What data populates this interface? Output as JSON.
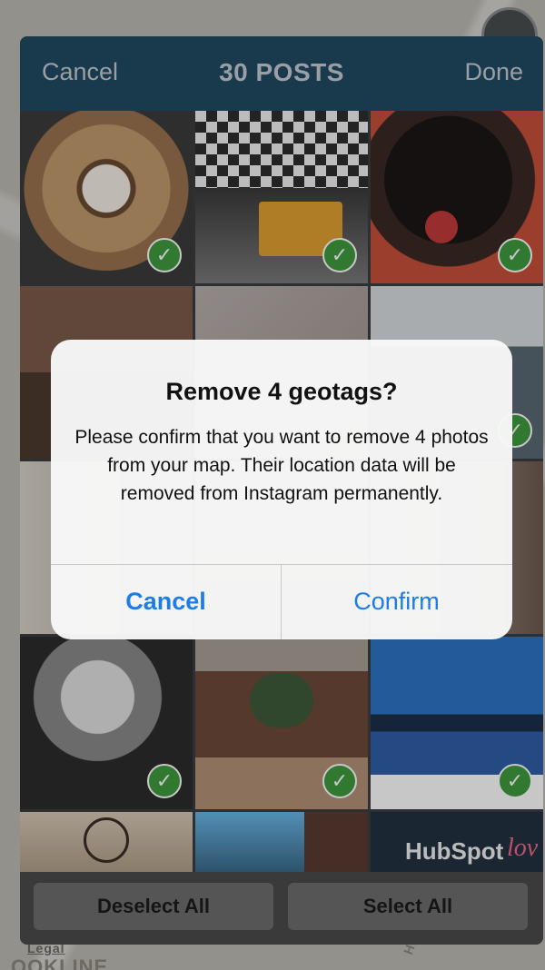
{
  "map": {
    "legal_label": "Legal",
    "area_label": "OOKLINE",
    "street_label": "Hill"
  },
  "nav": {
    "cancel_label": "Cancel",
    "title": "30 POSTS",
    "done_label": "Done"
  },
  "photos": [
    {
      "name": "coffee-on-wood",
      "checked": true
    },
    {
      "name": "espresso-machine",
      "checked": true
    },
    {
      "name": "black-dog",
      "checked": true
    },
    {
      "name": "red-brick-buildings",
      "checked": false
    },
    {
      "name": "tree-branches",
      "checked": false
    },
    {
      "name": "office-group-photo",
      "checked": true
    },
    {
      "name": "window-frames",
      "checked": false
    },
    {
      "name": "interior-wall",
      "checked": false
    },
    {
      "name": "portrait-woman",
      "checked": false
    },
    {
      "name": "couple-selfie",
      "checked": true
    },
    {
      "name": "brick-courtyard",
      "checked": true
    },
    {
      "name": "river-skyline",
      "checked": true
    },
    {
      "name": "chandelier-ceiling",
      "checked": false
    },
    {
      "name": "street-lamp-buildings",
      "checked": false
    },
    {
      "name": "hubspot-sign",
      "checked": false
    }
  ],
  "photo_text": {
    "hubspot": "HubSpot",
    "hubspot_script": "lov"
  },
  "bottom": {
    "deselect_all_label": "Deselect All",
    "select_all_label": "Select All"
  },
  "alert": {
    "title": "Remove 4 geotags?",
    "message": "Please confirm that you want to remove 4 photos from your map. Their location data will be removed from Instagram permanently.",
    "cancel_label": "Cancel",
    "confirm_label": "Confirm"
  },
  "colors": {
    "nav_bg": "#214a63",
    "check_green": "#3f9a3f",
    "ios_blue": "#1c7ce8"
  }
}
